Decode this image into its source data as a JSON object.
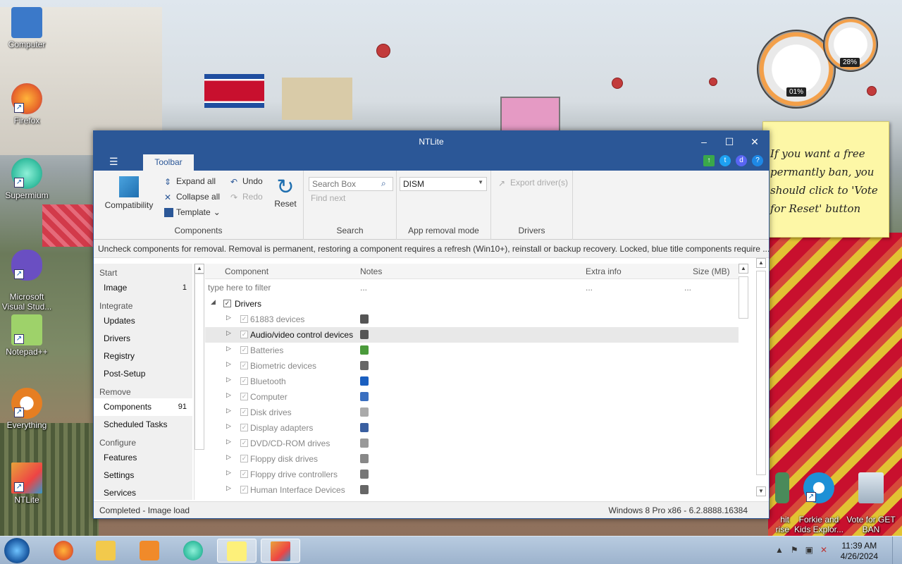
{
  "desktop": {
    "icons": [
      {
        "label": "Computer",
        "icon": "computer-icon",
        "color": "#3b79c9"
      },
      {
        "label": "Firefox",
        "icon": "firefox-icon",
        "color": "#e8682a"
      },
      {
        "label": "Supermium",
        "icon": "supermium-icon",
        "color": "#3cc3a5"
      },
      {
        "label": "Microsoft\nVisual Stud...",
        "icon": "visual-studio-icon",
        "color": "#6a4fc2"
      },
      {
        "label": "Notepad++",
        "icon": "notepadpp-icon",
        "color": "#7bbf4a"
      },
      {
        "label": "Everything",
        "icon": "everything-icon",
        "color": "#e67e22"
      },
      {
        "label": "NTLite",
        "icon": "ntlite-icon",
        "color": "#e8a33a"
      },
      {
        "label": "hit\nrise",
        "icon": "app-icon",
        "color": "#4a8a5a"
      },
      {
        "label": "Forkie and\nKids Explor...",
        "icon": "ie-icon",
        "color": "#1e90d6"
      },
      {
        "label": "Vote for GET\nBAN",
        "icon": "recycle-bin-icon",
        "color": "#9fb0c0"
      }
    ],
    "gadget": {
      "cpu": "01%",
      "ram": "28%"
    },
    "note": "If you want a free\npermantly ban, you\nshould click to 'Vote\nfor Reset' button"
  },
  "window": {
    "title": "NTLite",
    "tab": "Toolbar",
    "ribbon": {
      "compatibility": "Compatibility",
      "expand_all": "Expand all",
      "collapse_all": "Collapse all",
      "template": "Template",
      "undo": "Undo",
      "redo": "Redo",
      "reset": "Reset",
      "group_components": "Components",
      "search_placeholder": "Search Box",
      "find_next": "Find next",
      "group_search": "Search",
      "removal_mode": "DISM",
      "group_app_removal": "App removal mode",
      "export_drivers": "Export driver(s)",
      "group_drivers": "Drivers"
    },
    "hint": "Uncheck components for removal. Removal is permanent, restoring a component requires a refresh (Win10+), reinstall or backup recovery. Locked, blue title components require ...",
    "nav": {
      "start": "Start",
      "image": "Image",
      "image_count": "1",
      "integrate": "Integrate",
      "updates": "Updates",
      "drivers": "Drivers",
      "registry": "Registry",
      "post_setup": "Post-Setup",
      "remove": "Remove",
      "components": "Components",
      "components_count": "91",
      "scheduled_tasks": "Scheduled Tasks",
      "configure": "Configure",
      "features": "Features",
      "settings": "Settings",
      "services": "Services"
    },
    "columns": {
      "component": "Component",
      "notes": "Notes",
      "extra": "Extra info",
      "size": "Size (MB)"
    },
    "filter": {
      "placeholder": "type here to filter",
      "notes": "...",
      "extra": "...",
      "size": "..."
    },
    "tree_root": "Drivers",
    "rows": [
      {
        "name": "61883 devices",
        "icon_color": "#555"
      },
      {
        "name": "Audio/video control devices",
        "icon_color": "#555"
      },
      {
        "name": "Batteries",
        "icon_color": "#4a9a3a"
      },
      {
        "name": "Biometric devices",
        "icon_color": "#666"
      },
      {
        "name": "Bluetooth",
        "icon_color": "#1a5fc0"
      },
      {
        "name": "Computer",
        "icon_color": "#3a6fc0"
      },
      {
        "name": "Disk drives",
        "icon_color": "#aaa"
      },
      {
        "name": "Display adapters",
        "icon_color": "#3a5fa0"
      },
      {
        "name": "DVD/CD-ROM drives",
        "icon_color": "#999"
      },
      {
        "name": "Floppy disk drives",
        "icon_color": "#888"
      },
      {
        "name": "Floppy drive controllers",
        "icon_color": "#777"
      },
      {
        "name": "Human Interface Devices",
        "icon_color": "#666"
      }
    ],
    "status_left": "Completed - Image load",
    "status_right": "Windows 8 Pro x86 - 6.2.8888.16384"
  },
  "taskbar": {
    "time": "11:39 AM",
    "date": "4/26/2024"
  }
}
